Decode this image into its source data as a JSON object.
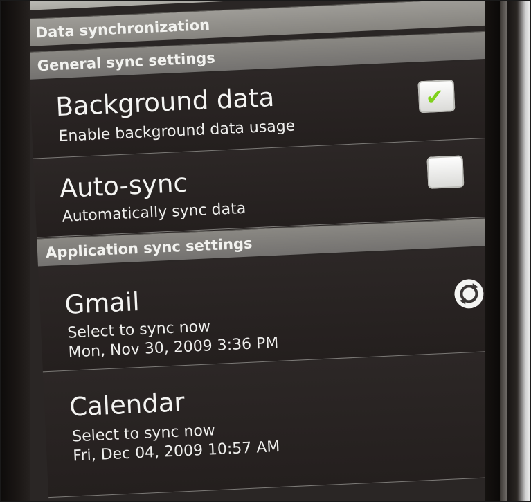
{
  "headers": {
    "data_sync": "Data synchronization",
    "general_sync": "General sync settings",
    "app_sync": "Application sync settings"
  },
  "settings": [
    {
      "title": "Background data",
      "subtitle": "Enable background data usage",
      "checked": true
    },
    {
      "title": "Auto-sync",
      "subtitle": "Automatically sync data",
      "checked": false
    }
  ],
  "accounts": [
    {
      "title": "Gmail",
      "line1": "Select to sync now",
      "line2": "Mon, Nov 30, 2009 3:36 PM",
      "icon": "sync-icon"
    },
    {
      "title": "Calendar",
      "line1": "Select to sync now",
      "line2": "Fri, Dec 04, 2009 10:57 AM"
    }
  ],
  "colors": {
    "checkmark": "#7fd11b",
    "header_bg": "#8a8883",
    "row_bg": "#2a2625"
  }
}
